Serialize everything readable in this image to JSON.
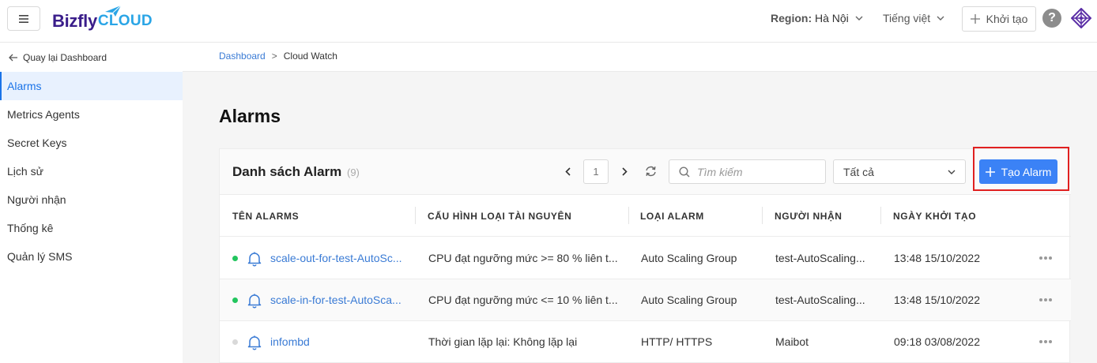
{
  "header": {
    "logo_part1": "Bizfly",
    "logo_part2": "CLOUD",
    "region_label": "Region:",
    "region_value": "Hà Nội",
    "language": "Tiếng việt",
    "create_label": "Khởi tạo",
    "help_symbol": "?"
  },
  "sidebar": {
    "back_label": "Quay lại Dashboard",
    "items": [
      {
        "label": "Alarms",
        "active": true
      },
      {
        "label": "Metrics Agents"
      },
      {
        "label": "Secret Keys"
      },
      {
        "label": "Lịch sử"
      },
      {
        "label": "Người nhận"
      },
      {
        "label": "Thống kê"
      },
      {
        "label": "Quản lý SMS"
      }
    ]
  },
  "breadcrumb": {
    "home": "Dashboard",
    "separator": ">",
    "current": "Cloud Watch"
  },
  "page": {
    "title": "Alarms"
  },
  "card": {
    "title": "Danh sách Alarm",
    "count": "(9)",
    "page_number": "1",
    "search_placeholder": "Tìm kiếm",
    "filter_value": "Tất cả",
    "create_button": "Tạo Alarm"
  },
  "table": {
    "columns": [
      "TÊN ALARMS",
      "CẤU HÌNH LOẠI TÀI NGUYÊN",
      "LOẠI ALARM",
      "NGƯỜI NHẬN",
      "NGÀY KHỞI TẠO"
    ],
    "rows": [
      {
        "status": "active",
        "status_color": "#22c55e",
        "name": "scale-out-for-test-AutoSc...",
        "config": "CPU đạt ngưỡng mức >= 80 % liên t...",
        "type": "Auto Scaling Group",
        "receiver": "test-AutoScaling...",
        "created": "13:48 15/10/2022"
      },
      {
        "status": "active",
        "status_color": "#22c55e",
        "name": "scale-in-for-test-AutoSca...",
        "config": "CPU đạt ngưỡng mức <= 10 % liên t...",
        "type": "Auto Scaling Group",
        "receiver": "test-AutoScaling...",
        "created": "13:48 15/10/2022"
      },
      {
        "status": "inactive",
        "status_color": "#d9d9d9",
        "name": "infombd",
        "config": "Thời gian lặp lại: Không lặp lại",
        "type": "HTTP/ HTTPS",
        "receiver": "Maibot",
        "created": "09:18 03/08/2022"
      }
    ]
  },
  "colors": {
    "accent": "#3b82f6",
    "link": "#3a7bd5",
    "active_bg": "#e8f1fe",
    "highlight": "#e02020",
    "logo_primary": "#3a1d8a",
    "logo_secondary": "#2aa5e6"
  },
  "icons": [
    "hamburger-icon",
    "paper-plane-icon",
    "chevron-down-icon",
    "plus-icon",
    "help-icon",
    "avatar-icon",
    "arrow-left-icon",
    "chevron-left-icon",
    "chevron-right-icon",
    "refresh-icon",
    "search-icon",
    "bell-icon",
    "more-icon"
  ]
}
